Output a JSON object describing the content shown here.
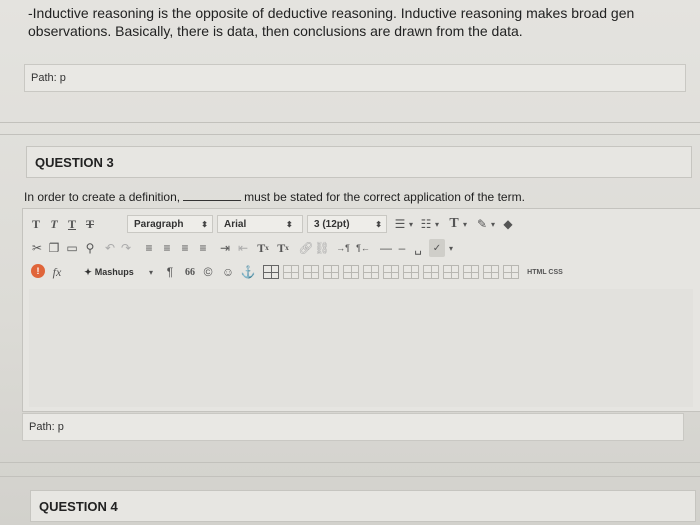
{
  "answer": {
    "line1": "-Inductive reasoning is the opposite of deductive reasoning. Inductive reasoning makes broad gen",
    "line2": "observations. Basically, there is data, then conclusions are drawn from the data."
  },
  "path_label_1": "Path: p",
  "question3": {
    "heading": "QUESTION 3",
    "prompt_before": "In order to create a definition,",
    "prompt_after": "must be stated for the correct application of the term."
  },
  "editor": {
    "toolbar1": {
      "t1": "T",
      "t2": "T",
      "t3": "T",
      "t4": "T",
      "paragraph_select": "Paragraph",
      "font_select": "Arial",
      "size_select": "3 (12pt)",
      "text_color": "T"
    },
    "toolbar2": {
      "superscript": "T",
      "subscript": "T",
      "sup_mark": "x",
      "sub_mark": "x"
    },
    "toolbar3": {
      "formula": "fx",
      "mashups_label": "Mashups",
      "paragraph_mark": "¶",
      "quote": "66",
      "html_css": "HTML CSS"
    }
  },
  "path_label_2": "Path: p",
  "question4": {
    "heading": "QUESTION 4"
  },
  "colors": {
    "error_badge": "#e0653a",
    "page_bg": "#e4e3df"
  }
}
